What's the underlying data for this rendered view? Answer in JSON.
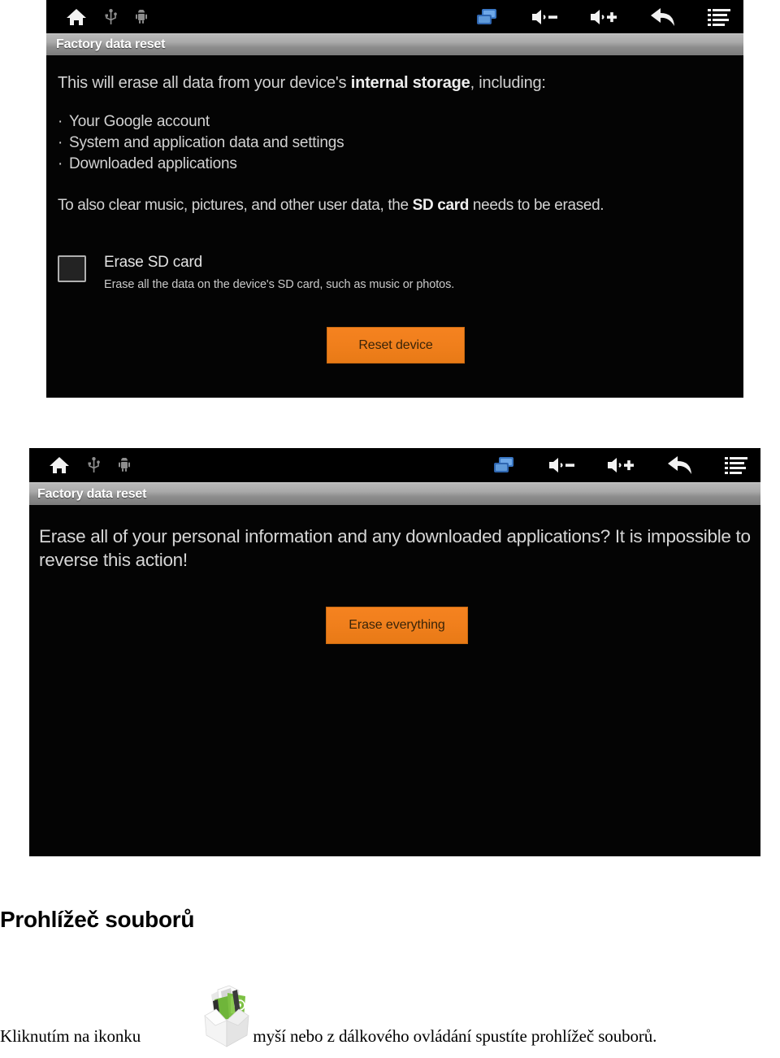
{
  "screenshots": [
    {
      "name": "factory-data-reset-settings",
      "status_bar": {
        "left_icons": [
          "home-icon",
          "usb-icon",
          "android-robot-icon"
        ],
        "right_icons": [
          "screens-icon",
          "volume-down-icon",
          "volume-up-icon",
          "back-arrow-icon",
          "menu-list-icon"
        ]
      },
      "title": "Factory data reset",
      "lead_text_before": "This will erase all data from your device's ",
      "lead_text_bold": "internal storage",
      "lead_text_after": ", including:",
      "bullets": [
        "Your Google account",
        "System and application data and settings",
        "Downloaded applications"
      ],
      "sd_note_before": "To also clear music, pictures, and other user data, the ",
      "sd_note_bold": "SD card",
      "sd_note_after": " needs to be erased.",
      "checkbox": {
        "label": "Erase SD card",
        "description": "Erase all the data on the device's SD card, such as music or photos.",
        "checked": false
      },
      "primary_button": "Reset device"
    },
    {
      "name": "factory-data-reset-confirm",
      "status_bar": {
        "left_icons": [
          "home-icon",
          "usb-icon",
          "android-robot-icon"
        ],
        "right_icons": [
          "screens-icon",
          "volume-down-icon",
          "volume-up-icon",
          "back-arrow-icon",
          "menu-list-icon"
        ]
      },
      "title": "Factory data reset",
      "warning": "Erase all of your personal information and any downloaded applications? It is impossible to reverse this action!",
      "primary_button": "Erase everything"
    }
  ],
  "document": {
    "heading": "Prohlížeč souborů",
    "caption_before": "Kliknutím na ikonku",
    "caption_after": "myší nebo z dálkového ovládání spustíte prohlížeč souborů.",
    "icon_name": "file-browser-box-icon"
  },
  "colors": {
    "button_orange": "#f07f1c",
    "button_text": "#3a2408",
    "screen_background": "#040404",
    "title_bar_gray": "#a0a0a0",
    "body_text": "#d2d2d2"
  }
}
